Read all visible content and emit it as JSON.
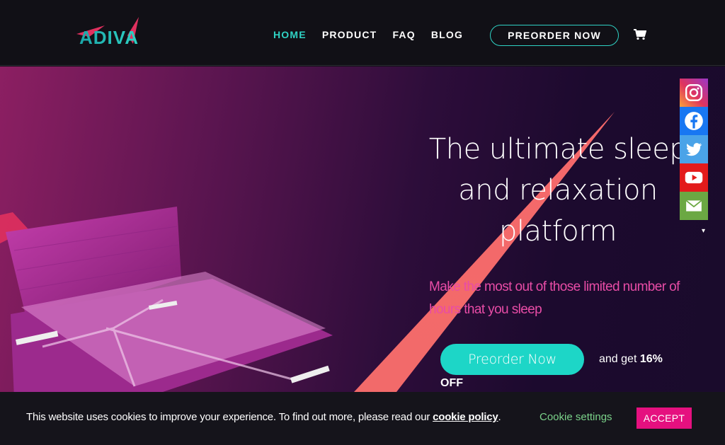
{
  "brand": {
    "logo_text": "ADIVA"
  },
  "nav": {
    "items": [
      {
        "label": "HOME",
        "active": true
      },
      {
        "label": "PRODUCT",
        "active": false
      },
      {
        "label": "FAQ",
        "active": false
      },
      {
        "label": "BLOG",
        "active": false
      }
    ],
    "preorder_label": "PREORDER NOW",
    "cart_icon": "cart-icon"
  },
  "hero": {
    "title": "The ultimate sleep and relaxation platform",
    "subtitle": "Make the most out of those limited number of hours that you sleep",
    "cta_label": "Preorder Now",
    "cta_note_prefix": "and get",
    "cta_note_percent": "16%",
    "cta_note_suffix": "OFF"
  },
  "social": [
    {
      "name": "Instagram",
      "icon": "instagram-icon",
      "color": "#e0345d"
    },
    {
      "name": "Facebook",
      "icon": "facebook-icon",
      "color": "#1877f2"
    },
    {
      "name": "Twitter",
      "icon": "twitter-icon",
      "color": "#4aa3e8"
    },
    {
      "name": "YouTube",
      "icon": "youtube-icon",
      "color": "#e31b1b"
    },
    {
      "name": "Email",
      "icon": "email-icon",
      "color": "#6ba843"
    }
  ],
  "cookie": {
    "text": "This website uses cookies to improve your experience. To find out more, please read our",
    "policy_link": "cookie policy",
    "period": ".",
    "settings_label": "Cookie settings",
    "accept_label": "ACCEPT"
  },
  "colors": {
    "accent_teal": "#2fd2c4",
    "accent_pink": "#e5107f",
    "header_bg": "#111016"
  }
}
